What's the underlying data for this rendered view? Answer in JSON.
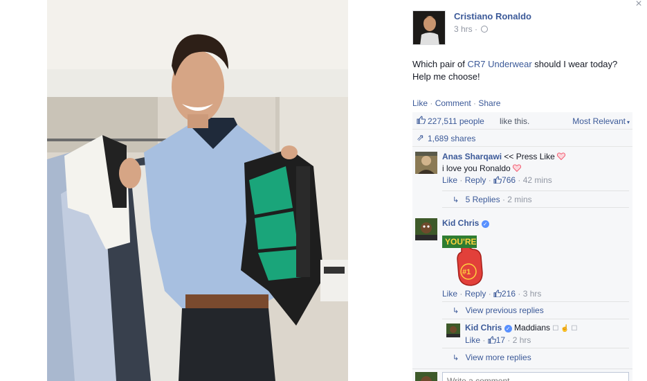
{
  "photo": {
    "alt": "Photo"
  },
  "close_label": "×",
  "post": {
    "author": "Cristiano Ronaldo",
    "time": "3 hrs ·",
    "text_before": "Which pair of ",
    "link_text": "CR7 Underwear",
    "text_after": " should I wear today? Help me choose!",
    "actions": {
      "like": "Like",
      "comment": "Comment",
      "share": "Share",
      "separator": " · "
    }
  },
  "stats": {
    "likes_count": "227,511 people",
    "likes_rest": " like this.",
    "sort_label": "Most Relevant",
    "shares": "1,689 shares"
  },
  "comments": [
    {
      "author": "Anas Sharqawi",
      "text_line1": " << Press Like",
      "text_line2": "i love you Ronaldo",
      "like": "Like",
      "reply": "Reply",
      "likes": "766",
      "time": "42 mins",
      "replies_label": "5 Replies",
      "replies_time": "2 mins"
    },
    {
      "author": "Kid Chris",
      "sticker_line1": "YOU'RE",
      "sticker_line2": "#1",
      "like": "Like",
      "reply": "Reply",
      "likes": "216",
      "time": "3 hrs",
      "view_previous": "View previous replies",
      "reply_item": {
        "author": "Kid Chris",
        "text": " Maddians ",
        "like": "Like",
        "likes": "17",
        "time": "2 hrs"
      },
      "view_more": "View more replies"
    }
  ],
  "write_comment": {
    "placeholder": "Write a comment..."
  },
  "colors": {
    "link": "#3b5998",
    "meta": "#9197a3",
    "panel_bg": "#f6f7f9",
    "heart": "#f25268"
  }
}
